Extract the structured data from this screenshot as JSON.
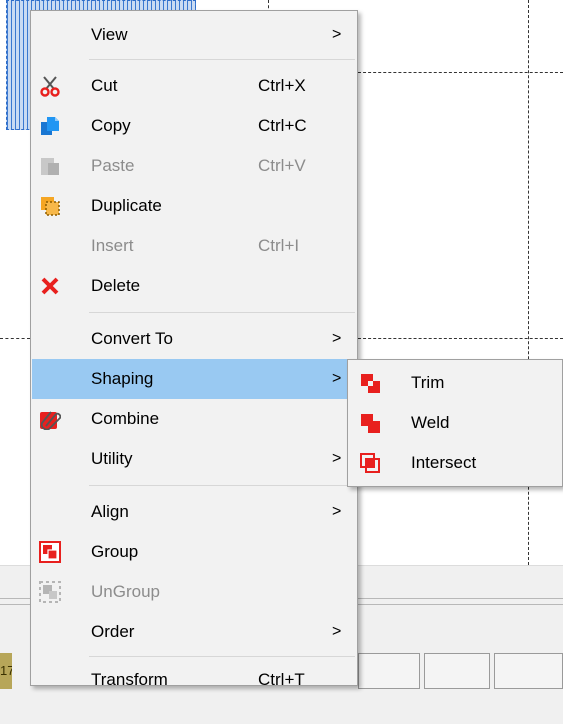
{
  "context_menu": {
    "items": [
      {
        "label": "View",
        "shortcut": "",
        "submenu": true,
        "disabled": false,
        "icon": ""
      },
      {
        "label": "Cut",
        "shortcut": "Ctrl+X",
        "submenu": false,
        "disabled": false,
        "icon": "scissors-icon"
      },
      {
        "label": "Copy",
        "shortcut": "Ctrl+C",
        "submenu": false,
        "disabled": false,
        "icon": "copy-icon"
      },
      {
        "label": "Paste",
        "shortcut": "Ctrl+V",
        "submenu": false,
        "disabled": true,
        "icon": "paste-icon"
      },
      {
        "label": "Duplicate",
        "shortcut": "",
        "submenu": false,
        "disabled": false,
        "icon": "duplicate-icon"
      },
      {
        "label": "Insert",
        "shortcut": "Ctrl+I",
        "submenu": false,
        "disabled": true,
        "icon": ""
      },
      {
        "label": "Delete",
        "shortcut": "",
        "submenu": false,
        "disabled": false,
        "icon": "delete-x-icon"
      },
      {
        "label": "Convert To",
        "shortcut": "",
        "submenu": true,
        "disabled": false,
        "icon": ""
      },
      {
        "label": "Shaping",
        "shortcut": "",
        "submenu": true,
        "disabled": false,
        "highlighted": true,
        "icon": ""
      },
      {
        "label": "Combine",
        "shortcut": "",
        "submenu": false,
        "disabled": false,
        "icon": "paperclip-icon"
      },
      {
        "label": "Utility",
        "shortcut": "",
        "submenu": true,
        "disabled": false,
        "icon": ""
      },
      {
        "label": "Align",
        "shortcut": "",
        "submenu": true,
        "disabled": false,
        "icon": ""
      },
      {
        "label": "Group",
        "shortcut": "",
        "submenu": false,
        "disabled": false,
        "icon": "group-icon"
      },
      {
        "label": "UnGroup",
        "shortcut": "",
        "submenu": false,
        "disabled": true,
        "icon": "ungroup-icon"
      },
      {
        "label": "Order",
        "shortcut": "",
        "submenu": true,
        "disabled": false,
        "icon": ""
      },
      {
        "label": "Transform",
        "shortcut": "Ctrl+T",
        "submenu": false,
        "disabled": false,
        "icon": ""
      }
    ]
  },
  "shaping_submenu": {
    "items": [
      {
        "label": "Trim",
        "icon": "trim-icon"
      },
      {
        "label": "Weld",
        "icon": "weld-icon"
      },
      {
        "label": "Intersect",
        "icon": "intersect-icon"
      }
    ]
  },
  "status_bar": {
    "left_text": "17"
  },
  "colors": {
    "menu_bg": "#f2f2f2",
    "highlight": "#99c9f2",
    "disabled_text": "#8c8c8c",
    "icon_red": "#e8201e",
    "icon_blue": "#1976d2",
    "icon_orange": "#f5a623"
  }
}
